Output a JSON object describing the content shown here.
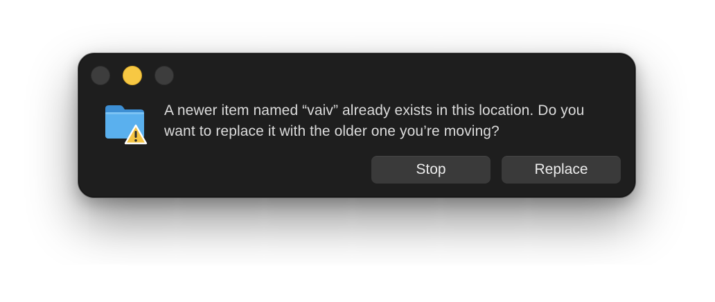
{
  "dialog": {
    "message": "A newer item named “vaiv” already exists in this location. Do you want to replace it with the older one you’re moving?",
    "icon": "folder-warning-icon",
    "buttons": {
      "stop_label": "Stop",
      "replace_label": "Replace"
    }
  },
  "window_controls": [
    "close-button",
    "minimize-button",
    "zoom-button"
  ],
  "colors": {
    "dialog_background": "#1e1e1e",
    "button_background": "#3a3a3a",
    "minimize_light": "#f7c843",
    "folder_blue": "#5ab0ee",
    "warning_yellow": "#f4c443"
  }
}
